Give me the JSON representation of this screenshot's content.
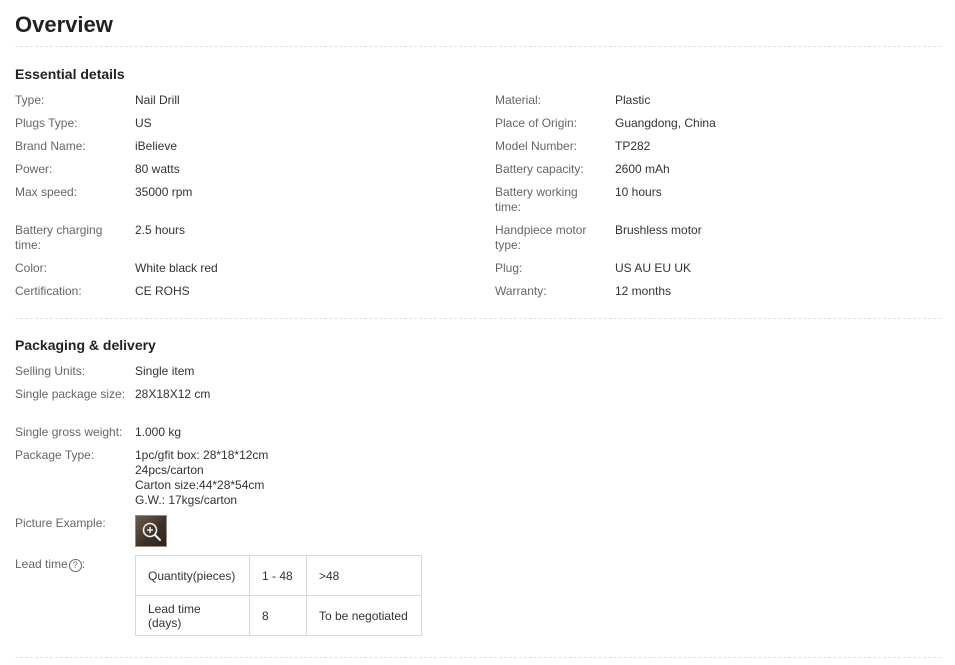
{
  "title": "Overview",
  "essential": {
    "heading": "Essential details",
    "left": [
      {
        "label": "Type:",
        "value": [
          "Nail Drill"
        ]
      },
      {
        "label": "Plugs Type:",
        "value": [
          "US"
        ]
      },
      {
        "label": "Brand Name:",
        "value": [
          "iBelieve"
        ]
      },
      {
        "label": "Power:",
        "value": [
          "80 watts"
        ]
      },
      {
        "label": "Max speed:",
        "value": [
          "35000 rpm"
        ]
      },
      {
        "label": "Battery charging time:",
        "value": [
          "2.5 hours"
        ]
      },
      {
        "label": "Color:",
        "value": [
          "White black red"
        ]
      },
      {
        "label": "Certification:",
        "value": [
          "CE ROHS"
        ]
      }
    ],
    "right": [
      {
        "label": "Material:",
        "value": [
          "Plastic"
        ]
      },
      {
        "label": "Place of Origin:",
        "value": [
          "Guangdong, China"
        ]
      },
      {
        "label": "Model Number:",
        "value": [
          "TP282"
        ]
      },
      {
        "label": "Battery capacity:",
        "value": [
          "2600 mAh"
        ]
      },
      {
        "label": "Battery working time:",
        "value": [
          "10 hours"
        ]
      },
      {
        "label": "Handpiece motor type:",
        "value": [
          "Brushless motor"
        ]
      },
      {
        "label": "Plug:",
        "value": [
          "US AU EU UK"
        ]
      },
      {
        "label": "Warranty:",
        "value": [
          "12 months"
        ]
      }
    ]
  },
  "packaging": {
    "heading": "Packaging & delivery",
    "rows": [
      {
        "label": "Selling Units:",
        "value": [
          "Single item"
        ]
      },
      {
        "label": "Single package size:",
        "value": [
          "28X18X12 cm"
        ]
      },
      {
        "label": "Single gross weight:",
        "value": [
          "1.000 kg"
        ]
      },
      {
        "label": "Package Type:",
        "value": [
          "1pc/gfit box: 28*18*12cm",
          "24pcs/carton",
          "Carton size:44*28*54cm",
          "G.W.: 17kgs/carton"
        ]
      }
    ],
    "picture_label": "Picture Example:",
    "picture_icon": "zoom-in-icon",
    "lead_label": "Lead time",
    "lead_help_icon": "?",
    "lead_colon": ":",
    "lead_table": [
      [
        "Quantity(pieces)",
        "1 - 48",
        ">48"
      ],
      [
        "Lead time (days)",
        "8",
        "To be negotiated"
      ]
    ]
  }
}
